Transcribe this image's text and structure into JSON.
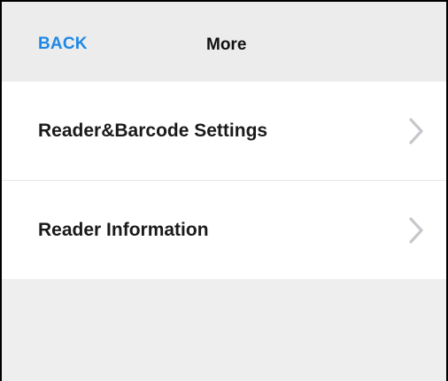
{
  "header": {
    "back_label": "BACK",
    "title": "More"
  },
  "menu": {
    "items": [
      {
        "label": "Reader&Barcode Settings",
        "icon": "chevron-right-icon"
      },
      {
        "label": "Reader Information",
        "icon": "chevron-right-icon"
      }
    ]
  },
  "colors": {
    "accent": "#1e88e5",
    "header_bg": "#ececec",
    "chevron": "#c7c7cc"
  }
}
